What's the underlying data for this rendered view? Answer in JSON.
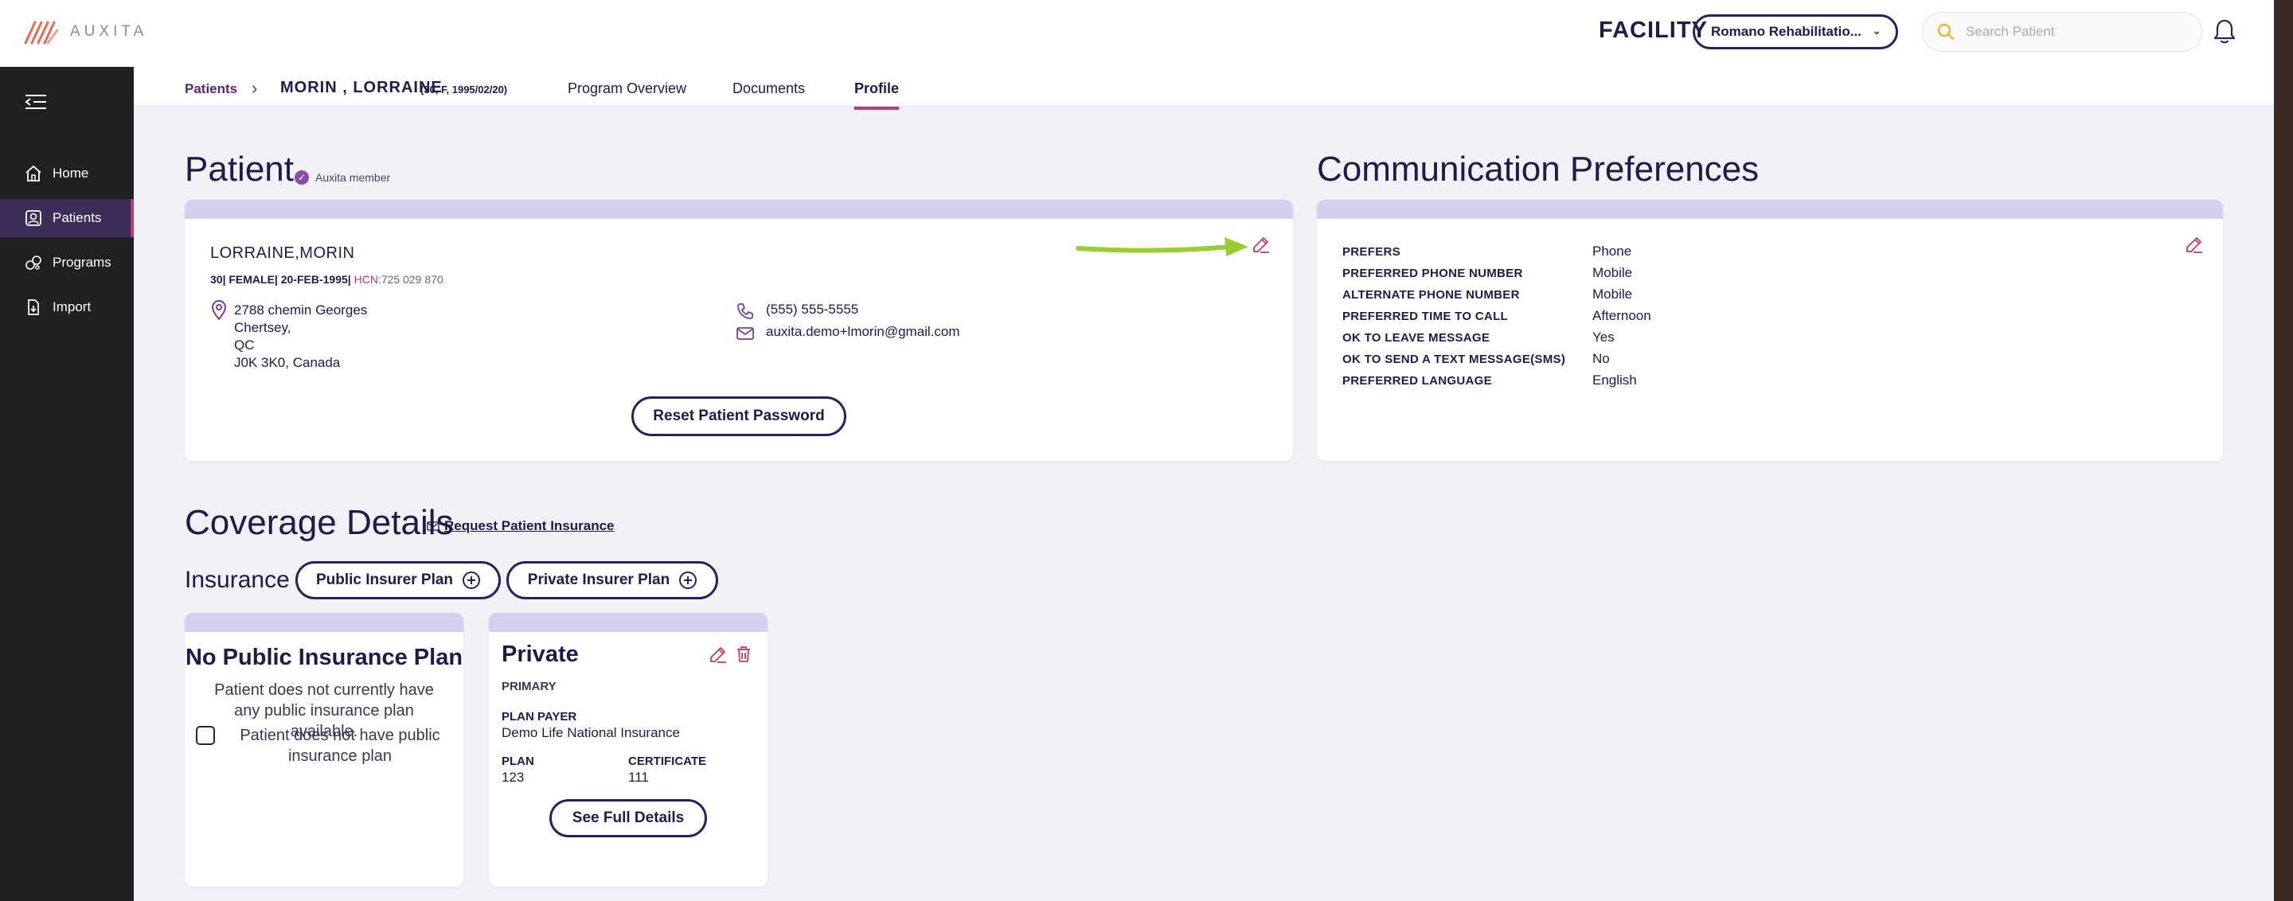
{
  "app": {
    "logo_text": "AUXITA"
  },
  "header": {
    "facility_label": "FACILITY",
    "facility_value": "Romano Rehabilitatio...",
    "search_placeholder": "Search Patient"
  },
  "sidebar": {
    "items": [
      {
        "label": "Home",
        "icon": "home-icon"
      },
      {
        "label": "Patients",
        "icon": "patients-icon"
      },
      {
        "label": "Programs",
        "icon": "programs-icon"
      },
      {
        "label": "Import",
        "icon": "import-icon"
      }
    ],
    "active": "Patients"
  },
  "subnav": {
    "breadcrumb_root": "Patients",
    "patient_name": "MORIN , LORRAINE",
    "patient_meta": "(30, F, 1995/02/20)",
    "tabs": [
      {
        "label": "Program Overview"
      },
      {
        "label": "Documents"
      },
      {
        "label": "Profile"
      }
    ],
    "active_tab": "Profile"
  },
  "patient": {
    "heading": "Patient",
    "member_badge": "Auxita member",
    "name": "LORRAINE,MORIN",
    "meta_prefix": "30| FEMALE| 20-FEB-1995|",
    "hcn_label": "HCN:",
    "hcn_value": "725 029 870",
    "address_lines": [
      "2788 chemin Georges",
      "Chertsey,",
      "QC",
      "J0K 3K0, Canada"
    ],
    "phone": "(555) 555-5555",
    "email": "auxita.demo+lmorin@gmail.com",
    "reset_button": "Reset Patient Password"
  },
  "communication": {
    "heading": "Communication Preferences",
    "rows": [
      {
        "label": "PREFERS",
        "value": "Phone"
      },
      {
        "label": "PREFERRED PHONE NUMBER",
        "value": "Mobile"
      },
      {
        "label": "ALTERNATE PHONE NUMBER",
        "value": "Mobile"
      },
      {
        "label": "PREFERRED TIME TO CALL",
        "value": "Afternoon"
      },
      {
        "label": "OK TO LEAVE MESSAGE",
        "value": "Yes"
      },
      {
        "label": "OK TO SEND A TEXT MESSAGE(SMS)",
        "value": "No"
      },
      {
        "label": "PREFERRED LANGUAGE",
        "value": "English"
      }
    ]
  },
  "coverage": {
    "heading": "Coverage Details",
    "request_link": "Request Patient Insurance",
    "insurance_label": "Insurance",
    "public_button": "Public Insurer Plan",
    "private_button": "Private Insurer Plan",
    "no_public": {
      "title": "No Public Insurance Plan",
      "text": "Patient does not currently have any public insurance plan available.",
      "checkbox_label": "Patient does not have public insurance plan",
      "checked": false
    },
    "private": {
      "title": "Private",
      "type": "PRIMARY",
      "plan_payer_label": "PLAN PAYER",
      "plan_payer_value": "Demo Life National Insurance",
      "plan_label": "PLAN",
      "plan_value": "123",
      "certificate_label": "CERTIFICATE",
      "certificate_value": "111",
      "details_button": "See Full Details"
    }
  },
  "colors": {
    "primary": "#2c1f5f",
    "accent": "#c0396b",
    "card_band": "#d3d0ee",
    "sidebar_bg": "#211f22",
    "annotation_arrow": "#9acd32"
  }
}
